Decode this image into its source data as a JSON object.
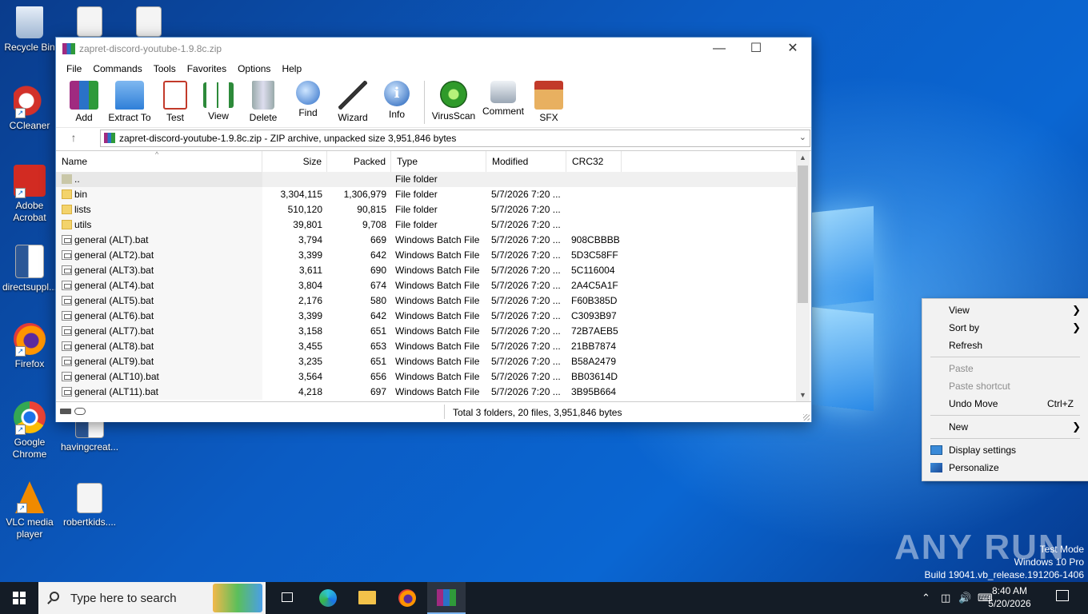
{
  "desktop": {
    "icons": [
      {
        "label": "Recycle Bin"
      },
      {
        "label": "CCleaner"
      },
      {
        "label": "Adobe Acrobat"
      },
      {
        "label": "directsuppl..."
      },
      {
        "label": "Firefox"
      },
      {
        "label": "Google Chrome"
      },
      {
        "label": "havingcreat..."
      },
      {
        "label": "VLC media player"
      },
      {
        "label": "robertkids...."
      }
    ]
  },
  "window": {
    "title": "zapret-discord-youtube-1.9.8c.zip",
    "menu": [
      "File",
      "Commands",
      "Tools",
      "Favorites",
      "Options",
      "Help"
    ],
    "toolbar": [
      {
        "label": "Add",
        "icon": "add-archive-icon"
      },
      {
        "label": "Extract To",
        "icon": "extract-folder-icon"
      },
      {
        "label": "Test",
        "icon": "test-clipboard-icon"
      },
      {
        "label": "View",
        "icon": "view-book-icon"
      },
      {
        "label": "Delete",
        "icon": "trash-icon"
      },
      {
        "label": "Find",
        "icon": "magnifier-icon"
      },
      {
        "label": "Wizard",
        "icon": "wand-icon"
      },
      {
        "label": "Info",
        "icon": "info-icon"
      },
      {
        "label": "VirusScan",
        "icon": "virus-scan-icon"
      },
      {
        "label": "Comment",
        "icon": "comment-icon"
      },
      {
        "label": "SFX",
        "icon": "sfx-box-icon"
      }
    ],
    "address": "zapret-discord-youtube-1.9.8c.zip - ZIP archive, unpacked size 3,951,846 bytes",
    "columns": [
      "Name",
      "Size",
      "Packed",
      "Type",
      "Modified",
      "CRC32"
    ],
    "files": [
      {
        "name": "..",
        "size": "",
        "packed": "",
        "type": "File folder",
        "modified": "",
        "crc": "",
        "kind": "up"
      },
      {
        "name": "bin",
        "size": "3,304,115",
        "packed": "1,306,979",
        "type": "File folder",
        "modified": "5/7/2026 7:20 ...",
        "crc": "",
        "kind": "folder"
      },
      {
        "name": "lists",
        "size": "510,120",
        "packed": "90,815",
        "type": "File folder",
        "modified": "5/7/2026 7:20 ...",
        "crc": "",
        "kind": "folder"
      },
      {
        "name": "utils",
        "size": "39,801",
        "packed": "9,708",
        "type": "File folder",
        "modified": "5/7/2026 7:20 ...",
        "crc": "",
        "kind": "folder"
      },
      {
        "name": "general (ALT).bat",
        "size": "3,794",
        "packed": "669",
        "type": "Windows Batch File",
        "modified": "5/7/2026 7:20 ...",
        "crc": "908CBBBB",
        "kind": "bat"
      },
      {
        "name": "general (ALT2).bat",
        "size": "3,399",
        "packed": "642",
        "type": "Windows Batch File",
        "modified": "5/7/2026 7:20 ...",
        "crc": "5D3C58FF",
        "kind": "bat"
      },
      {
        "name": "general (ALT3).bat",
        "size": "3,611",
        "packed": "690",
        "type": "Windows Batch File",
        "modified": "5/7/2026 7:20 ...",
        "crc": "5C116004",
        "kind": "bat"
      },
      {
        "name": "general (ALT4).bat",
        "size": "3,804",
        "packed": "674",
        "type": "Windows Batch File",
        "modified": "5/7/2026 7:20 ...",
        "crc": "2A4C5A1F",
        "kind": "bat"
      },
      {
        "name": "general (ALT5).bat",
        "size": "2,176",
        "packed": "580",
        "type": "Windows Batch File",
        "modified": "5/7/2026 7:20 ...",
        "crc": "F60B385D",
        "kind": "bat"
      },
      {
        "name": "general (ALT6).bat",
        "size": "3,399",
        "packed": "642",
        "type": "Windows Batch File",
        "modified": "5/7/2026 7:20 ...",
        "crc": "C3093B97",
        "kind": "bat"
      },
      {
        "name": "general (ALT7).bat",
        "size": "3,158",
        "packed": "651",
        "type": "Windows Batch File",
        "modified": "5/7/2026 7:20 ...",
        "crc": "72B7AEB5",
        "kind": "bat"
      },
      {
        "name": "general (ALT8).bat",
        "size": "3,455",
        "packed": "653",
        "type": "Windows Batch File",
        "modified": "5/7/2026 7:20 ...",
        "crc": "21BB7874",
        "kind": "bat"
      },
      {
        "name": "general (ALT9).bat",
        "size": "3,235",
        "packed": "651",
        "type": "Windows Batch File",
        "modified": "5/7/2026 7:20 ...",
        "crc": "B58A2479",
        "kind": "bat"
      },
      {
        "name": "general (ALT10).bat",
        "size": "3,564",
        "packed": "656",
        "type": "Windows Batch File",
        "modified": "5/7/2026 7:20 ...",
        "crc": "BB03614D",
        "kind": "bat"
      },
      {
        "name": "general (ALT11).bat",
        "size": "4,218",
        "packed": "697",
        "type": "Windows Batch File",
        "modified": "5/7/2026 7:20 ...",
        "crc": "3B95B664",
        "kind": "bat"
      }
    ],
    "status": "Total 3 folders, 20 files, 3,951,846 bytes"
  },
  "context_menu": {
    "view": "View",
    "sort_by": "Sort by",
    "refresh": "Refresh",
    "paste": "Paste",
    "paste_shortcut": "Paste shortcut",
    "undo_move": "Undo Move",
    "undo_shortcut": "Ctrl+Z",
    "new": "New",
    "display_settings": "Display settings",
    "personalize": "Personalize"
  },
  "watermark": {
    "brand": "ANY RUN",
    "line1": "Test Mode",
    "line2": "Windows 10 Pro",
    "line3": "Build 19041.vb_release.191206-1406"
  },
  "taskbar": {
    "search_placeholder": "Type here to search",
    "time": "8:40 AM",
    "date": "5/20/2026"
  },
  "colors": {
    "accent": "#0a66d2",
    "taskbar": "#141c26",
    "selection": "#cce8ff"
  }
}
